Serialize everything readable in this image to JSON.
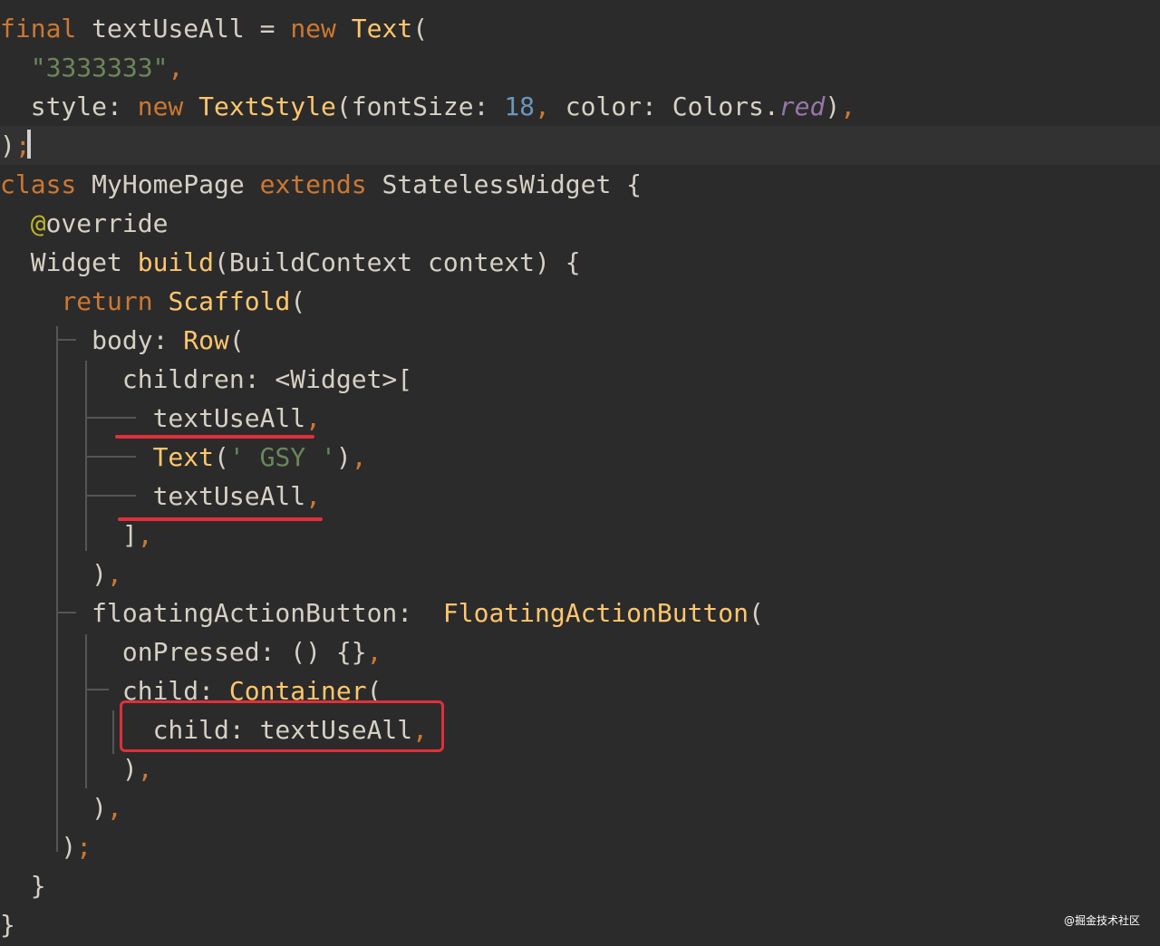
{
  "code_lines": [
    [
      {
        "t": "final",
        "c": "kw"
      },
      {
        "t": " textUseAll = ",
        "c": "plain"
      },
      {
        "t": "new",
        "c": "kw"
      },
      {
        "t": " ",
        "c": "plain"
      },
      {
        "t": "Text",
        "c": "fn"
      },
      {
        "t": "(",
        "c": "plain"
      }
    ],
    [
      {
        "t": "  ",
        "c": "plain"
      },
      {
        "t": "\"3333333\"",
        "c": "str"
      },
      {
        "t": ",",
        "c": "punct"
      }
    ],
    [
      {
        "t": "  style: ",
        "c": "plain"
      },
      {
        "t": "new",
        "c": "kw"
      },
      {
        "t": " ",
        "c": "plain"
      },
      {
        "t": "TextStyle",
        "c": "fn"
      },
      {
        "t": "(fontSize: ",
        "c": "plain"
      },
      {
        "t": "18",
        "c": "num"
      },
      {
        "t": ",",
        "c": "punct"
      },
      {
        "t": " color: Colors.",
        "c": "plain"
      },
      {
        "t": "red",
        "c": "purple"
      },
      {
        "t": ")",
        "c": "plain"
      },
      {
        "t": ",",
        "c": "punct"
      }
    ],
    [
      {
        "t": ")",
        "c": "plain"
      },
      {
        "t": ";",
        "c": "punct"
      }
    ],
    [
      {
        "t": "class",
        "c": "kw"
      },
      {
        "t": " MyHomePage ",
        "c": "plain"
      },
      {
        "t": "extends",
        "c": "kw"
      },
      {
        "t": " StatelessWidget {",
        "c": "plain"
      }
    ],
    [
      {
        "t": "  ",
        "c": "plain"
      },
      {
        "t": "@",
        "c": "ann"
      },
      {
        "t": "override",
        "c": "plain"
      }
    ],
    [
      {
        "t": "  Widget ",
        "c": "plain"
      },
      {
        "t": "build",
        "c": "fn"
      },
      {
        "t": "(BuildContext context) {",
        "c": "plain"
      }
    ],
    [
      {
        "t": "    ",
        "c": "plain"
      },
      {
        "t": "return",
        "c": "kw"
      },
      {
        "t": " ",
        "c": "plain"
      },
      {
        "t": "Scaffold",
        "c": "fn"
      },
      {
        "t": "(",
        "c": "plain"
      }
    ],
    [
      {
        "t": "      body: ",
        "c": "plain"
      },
      {
        "t": "Row",
        "c": "fn"
      },
      {
        "t": "(",
        "c": "plain"
      }
    ],
    [
      {
        "t": "        children: <Widget>[",
        "c": "plain"
      }
    ],
    [
      {
        "t": "          textUseAll",
        "c": "plain"
      },
      {
        "t": ",",
        "c": "punct"
      }
    ],
    [
      {
        "t": "          ",
        "c": "plain"
      },
      {
        "t": "Text",
        "c": "fn"
      },
      {
        "t": "(",
        "c": "plain"
      },
      {
        "t": "' GSY '",
        "c": "str"
      },
      {
        "t": ")",
        "c": "plain"
      },
      {
        "t": ",",
        "c": "punct"
      }
    ],
    [
      {
        "t": "          textUseAll",
        "c": "plain"
      },
      {
        "t": ",",
        "c": "punct"
      }
    ],
    [
      {
        "t": "        ]",
        "c": "plain"
      },
      {
        "t": ",",
        "c": "punct"
      }
    ],
    [
      {
        "t": "      )",
        "c": "plain"
      },
      {
        "t": ",",
        "c": "punct"
      }
    ],
    [
      {
        "t": "      floatingActionButton:  ",
        "c": "plain"
      },
      {
        "t": "FloatingActionButton",
        "c": "fn"
      },
      {
        "t": "(",
        "c": "plain"
      }
    ],
    [
      {
        "t": "        onPressed: () {}",
        "c": "plain"
      },
      {
        "t": ",",
        "c": "punct"
      }
    ],
    [
      {
        "t": "        child: ",
        "c": "plain"
      },
      {
        "t": "Container",
        "c": "fn"
      },
      {
        "t": "(",
        "c": "plain"
      }
    ],
    [
      {
        "t": "          child: textUseAll",
        "c": "plain"
      },
      {
        "t": ",",
        "c": "punct"
      }
    ],
    [
      {
        "t": "        )",
        "c": "plain"
      },
      {
        "t": ",",
        "c": "punct"
      }
    ],
    [
      {
        "t": "      )",
        "c": "plain"
      },
      {
        "t": ",",
        "c": "punct"
      }
    ],
    [
      {
        "t": "    )",
        "c": "plain"
      },
      {
        "t": ";",
        "c": "punct"
      }
    ],
    [
      {
        "t": "  }",
        "c": "plain"
      }
    ],
    [
      {
        "t": "}",
        "c": "plain"
      }
    ]
  ],
  "watermark": "@掘金技术社区"
}
